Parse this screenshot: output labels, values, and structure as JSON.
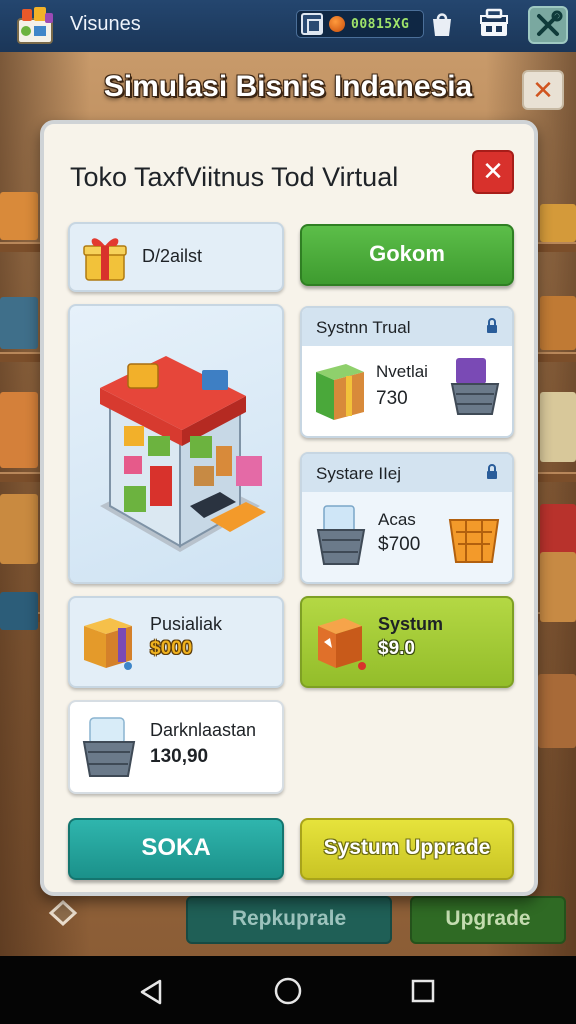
{
  "app": {
    "name": "Visunes"
  },
  "topbar": {
    "currency_value": "00815XG"
  },
  "title": "Simulasi Bisnis Indanesia",
  "outer_close": "✕",
  "panel": {
    "title": "Toko TaxfViitnus Tod Virtual",
    "close": "✕",
    "gift_card": {
      "label": "D/2ailst"
    },
    "green_button": {
      "label": "Gokom"
    },
    "system_card_1": {
      "header": "Systnn Trual",
      "label": "Nvetlai",
      "value": "730"
    },
    "system_card_2": {
      "header": "Systare IIej",
      "label": "Acas",
      "value": "$700"
    },
    "product_1": {
      "label": "Pusialiak",
      "value": "$000"
    },
    "product_2": {
      "label": "Systum",
      "value": "$9.0"
    },
    "product_3": {
      "label": "Darknlaastan",
      "value": "130,90"
    },
    "soka_button": {
      "label": "SOKA"
    },
    "system_upgrade_button": {
      "label": "Systum Upprade"
    }
  },
  "under_buttons": {
    "left": "Repkuprale",
    "right": "Upgrade"
  },
  "colors": {
    "green": "#4aa83a",
    "teal": "#1f9e97",
    "lime": "#a8cc36",
    "yellow": "#d8d52c",
    "red": "#d8312c"
  }
}
